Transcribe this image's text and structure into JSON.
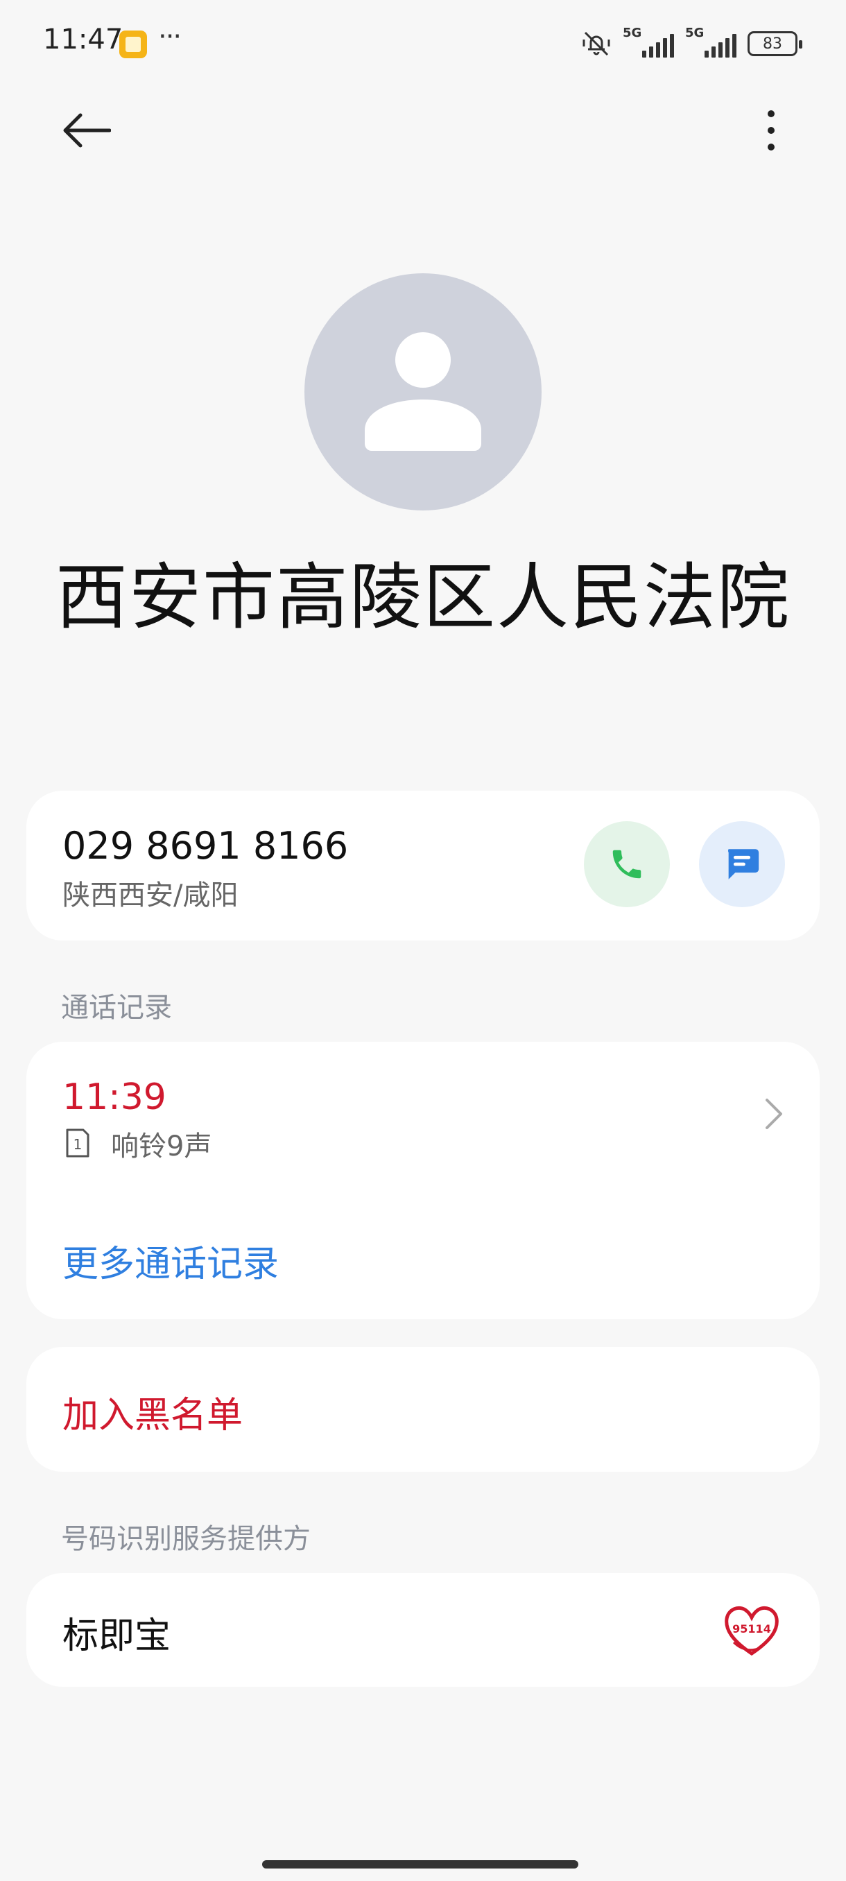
{
  "status_bar": {
    "time": "11:47",
    "network_1": "5G",
    "network_2": "5G",
    "battery": "83",
    "icons": [
      "note-icon",
      "more-dots-icon",
      "mute-icon",
      "signal-icon",
      "battery-icon"
    ]
  },
  "header": {
    "back_icon": "arrow-left-icon",
    "more_icon": "vertical-dots-icon"
  },
  "contact": {
    "avatar_icon": "person-icon",
    "name": "西安市高陵区人民法院"
  },
  "phone": {
    "number": "029 8691 8166",
    "location": "陕西西安/咸阳",
    "call_icon": "phone-icon",
    "message_icon": "message-icon",
    "call_color": "#2fbd5b",
    "message_color": "#2f7fe0"
  },
  "call_log": {
    "section_title": "通话记录",
    "entries": [
      {
        "time": "11:39",
        "sim": "1",
        "detail": "响铃9声"
      }
    ],
    "more_label": "更多通话记录",
    "missed_color": "#d0192e",
    "link_color": "#2f7fe0"
  },
  "block": {
    "label": "加入黑名单"
  },
  "provider": {
    "section_title": "号码识别服务提供方",
    "name": "标即宝",
    "logo_text": "95114"
  }
}
